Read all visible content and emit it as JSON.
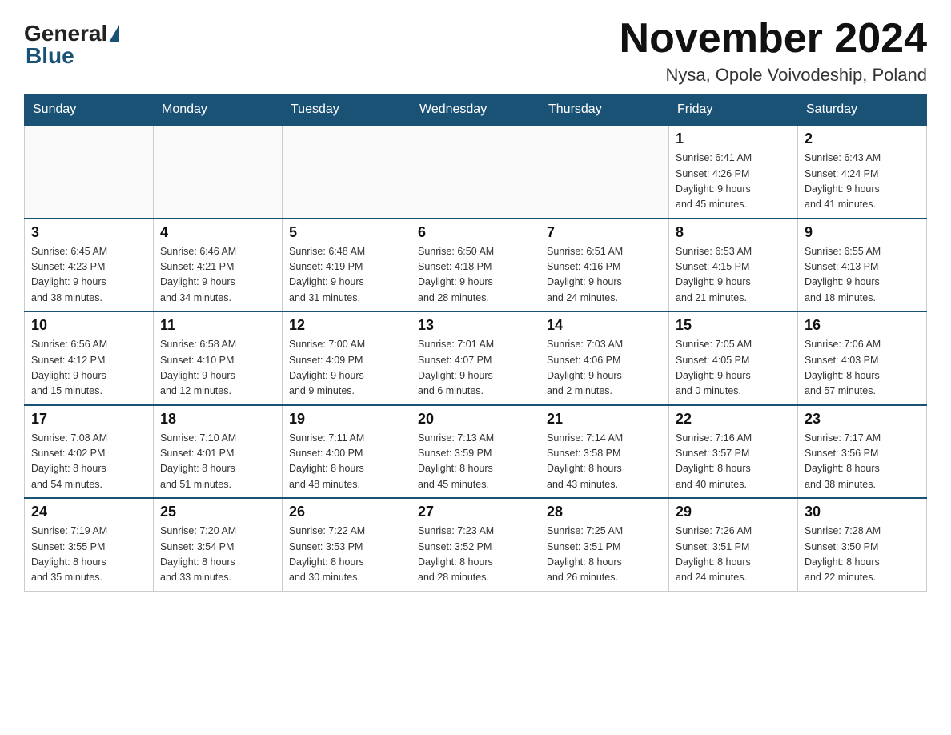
{
  "logo": {
    "general": "General",
    "blue": "Blue"
  },
  "title": {
    "month_year": "November 2024",
    "location": "Nysa, Opole Voivodeship, Poland"
  },
  "weekdays": [
    "Sunday",
    "Monday",
    "Tuesday",
    "Wednesday",
    "Thursday",
    "Friday",
    "Saturday"
  ],
  "weeks": [
    [
      {
        "day": "",
        "info": ""
      },
      {
        "day": "",
        "info": ""
      },
      {
        "day": "",
        "info": ""
      },
      {
        "day": "",
        "info": ""
      },
      {
        "day": "",
        "info": ""
      },
      {
        "day": "1",
        "info": "Sunrise: 6:41 AM\nSunset: 4:26 PM\nDaylight: 9 hours\nand 45 minutes."
      },
      {
        "day": "2",
        "info": "Sunrise: 6:43 AM\nSunset: 4:24 PM\nDaylight: 9 hours\nand 41 minutes."
      }
    ],
    [
      {
        "day": "3",
        "info": "Sunrise: 6:45 AM\nSunset: 4:23 PM\nDaylight: 9 hours\nand 38 minutes."
      },
      {
        "day": "4",
        "info": "Sunrise: 6:46 AM\nSunset: 4:21 PM\nDaylight: 9 hours\nand 34 minutes."
      },
      {
        "day": "5",
        "info": "Sunrise: 6:48 AM\nSunset: 4:19 PM\nDaylight: 9 hours\nand 31 minutes."
      },
      {
        "day": "6",
        "info": "Sunrise: 6:50 AM\nSunset: 4:18 PM\nDaylight: 9 hours\nand 28 minutes."
      },
      {
        "day": "7",
        "info": "Sunrise: 6:51 AM\nSunset: 4:16 PM\nDaylight: 9 hours\nand 24 minutes."
      },
      {
        "day": "8",
        "info": "Sunrise: 6:53 AM\nSunset: 4:15 PM\nDaylight: 9 hours\nand 21 minutes."
      },
      {
        "day": "9",
        "info": "Sunrise: 6:55 AM\nSunset: 4:13 PM\nDaylight: 9 hours\nand 18 minutes."
      }
    ],
    [
      {
        "day": "10",
        "info": "Sunrise: 6:56 AM\nSunset: 4:12 PM\nDaylight: 9 hours\nand 15 minutes."
      },
      {
        "day": "11",
        "info": "Sunrise: 6:58 AM\nSunset: 4:10 PM\nDaylight: 9 hours\nand 12 minutes."
      },
      {
        "day": "12",
        "info": "Sunrise: 7:00 AM\nSunset: 4:09 PM\nDaylight: 9 hours\nand 9 minutes."
      },
      {
        "day": "13",
        "info": "Sunrise: 7:01 AM\nSunset: 4:07 PM\nDaylight: 9 hours\nand 6 minutes."
      },
      {
        "day": "14",
        "info": "Sunrise: 7:03 AM\nSunset: 4:06 PM\nDaylight: 9 hours\nand 2 minutes."
      },
      {
        "day": "15",
        "info": "Sunrise: 7:05 AM\nSunset: 4:05 PM\nDaylight: 9 hours\nand 0 minutes."
      },
      {
        "day": "16",
        "info": "Sunrise: 7:06 AM\nSunset: 4:03 PM\nDaylight: 8 hours\nand 57 minutes."
      }
    ],
    [
      {
        "day": "17",
        "info": "Sunrise: 7:08 AM\nSunset: 4:02 PM\nDaylight: 8 hours\nand 54 minutes."
      },
      {
        "day": "18",
        "info": "Sunrise: 7:10 AM\nSunset: 4:01 PM\nDaylight: 8 hours\nand 51 minutes."
      },
      {
        "day": "19",
        "info": "Sunrise: 7:11 AM\nSunset: 4:00 PM\nDaylight: 8 hours\nand 48 minutes."
      },
      {
        "day": "20",
        "info": "Sunrise: 7:13 AM\nSunset: 3:59 PM\nDaylight: 8 hours\nand 45 minutes."
      },
      {
        "day": "21",
        "info": "Sunrise: 7:14 AM\nSunset: 3:58 PM\nDaylight: 8 hours\nand 43 minutes."
      },
      {
        "day": "22",
        "info": "Sunrise: 7:16 AM\nSunset: 3:57 PM\nDaylight: 8 hours\nand 40 minutes."
      },
      {
        "day": "23",
        "info": "Sunrise: 7:17 AM\nSunset: 3:56 PM\nDaylight: 8 hours\nand 38 minutes."
      }
    ],
    [
      {
        "day": "24",
        "info": "Sunrise: 7:19 AM\nSunset: 3:55 PM\nDaylight: 8 hours\nand 35 minutes."
      },
      {
        "day": "25",
        "info": "Sunrise: 7:20 AM\nSunset: 3:54 PM\nDaylight: 8 hours\nand 33 minutes."
      },
      {
        "day": "26",
        "info": "Sunrise: 7:22 AM\nSunset: 3:53 PM\nDaylight: 8 hours\nand 30 minutes."
      },
      {
        "day": "27",
        "info": "Sunrise: 7:23 AM\nSunset: 3:52 PM\nDaylight: 8 hours\nand 28 minutes."
      },
      {
        "day": "28",
        "info": "Sunrise: 7:25 AM\nSunset: 3:51 PM\nDaylight: 8 hours\nand 26 minutes."
      },
      {
        "day": "29",
        "info": "Sunrise: 7:26 AM\nSunset: 3:51 PM\nDaylight: 8 hours\nand 24 minutes."
      },
      {
        "day": "30",
        "info": "Sunrise: 7:28 AM\nSunset: 3:50 PM\nDaylight: 8 hours\nand 22 minutes."
      }
    ]
  ]
}
